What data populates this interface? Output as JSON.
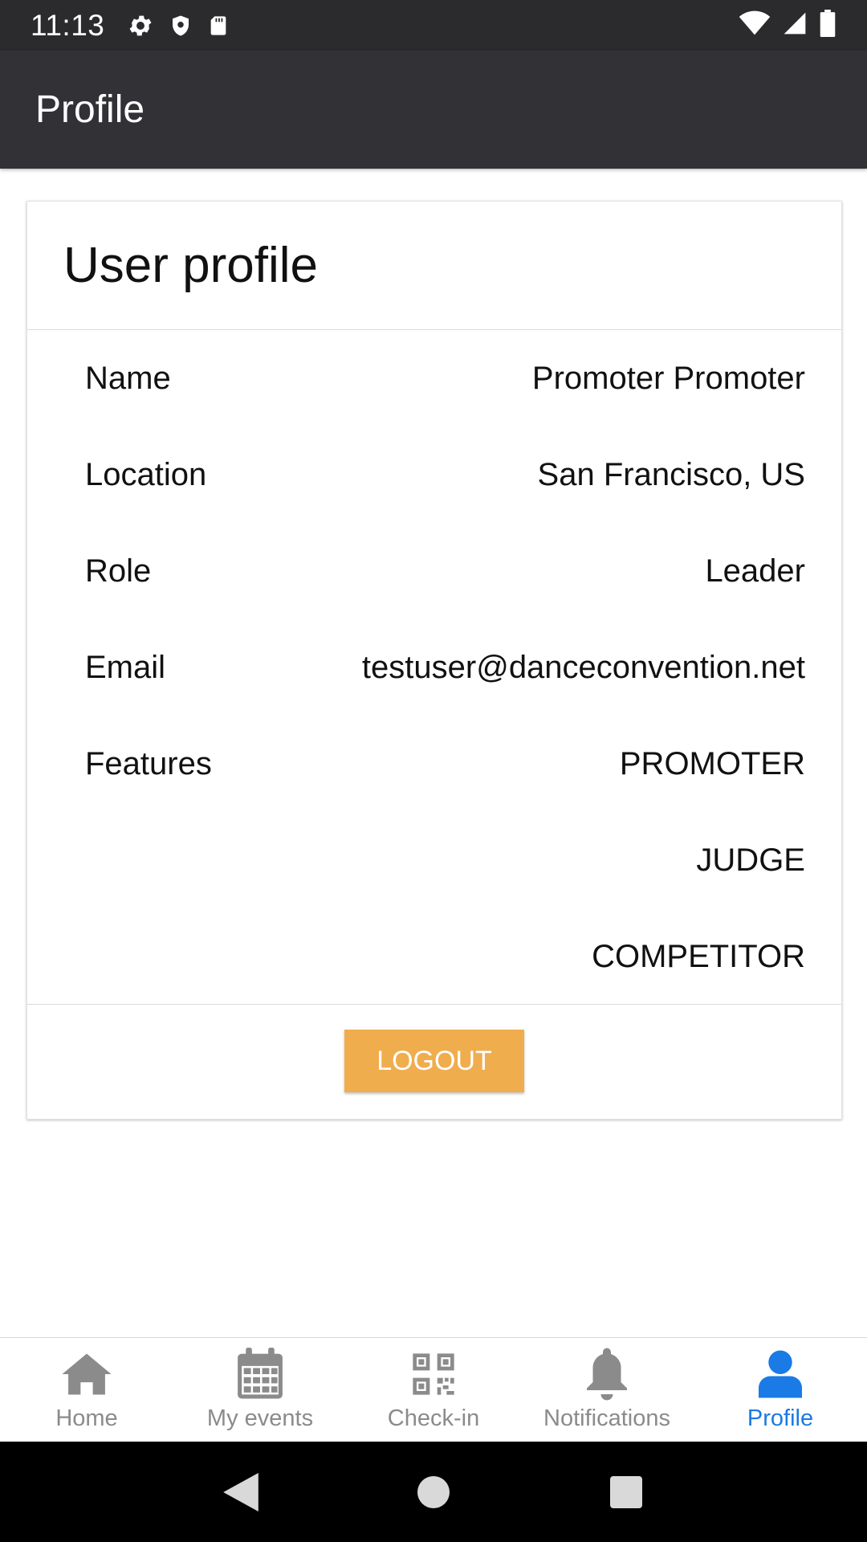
{
  "status_bar": {
    "time": "11:13",
    "icons_left": [
      "gear-icon",
      "shield-icon",
      "sd-card-icon"
    ],
    "icons_right": [
      "wifi-icon",
      "signal-icon",
      "battery-icon"
    ]
  },
  "app_bar": {
    "title": "Profile"
  },
  "card": {
    "title": "User profile",
    "rows": [
      {
        "label": "Name",
        "value": "Promoter Promoter"
      },
      {
        "label": "Location",
        "value": "San Francisco, US"
      },
      {
        "label": "Role",
        "value": "Leader"
      },
      {
        "label": "Email",
        "value": "testuser@danceconvention.net"
      },
      {
        "label": "Features",
        "value": "PROMOTER"
      }
    ],
    "extra_features": [
      "JUDGE",
      "COMPETITOR"
    ],
    "logout_label": "LOGOUT"
  },
  "bottom_nav": {
    "items": [
      {
        "label": "Home",
        "icon": "home-icon"
      },
      {
        "label": "My events",
        "icon": "calendar-icon"
      },
      {
        "label": "Check-in",
        "icon": "qr-code-icon"
      },
      {
        "label": "Notifications",
        "icon": "bell-icon"
      },
      {
        "label": "Profile",
        "icon": "person-icon"
      }
    ],
    "active": "Profile"
  },
  "colors": {
    "status_bar": "#2b2a2d",
    "app_bar": "#323135",
    "logout_button": "#f0ad4e",
    "nav_active": "#1a7ae6",
    "nav_inactive": "#8b8b8b"
  }
}
